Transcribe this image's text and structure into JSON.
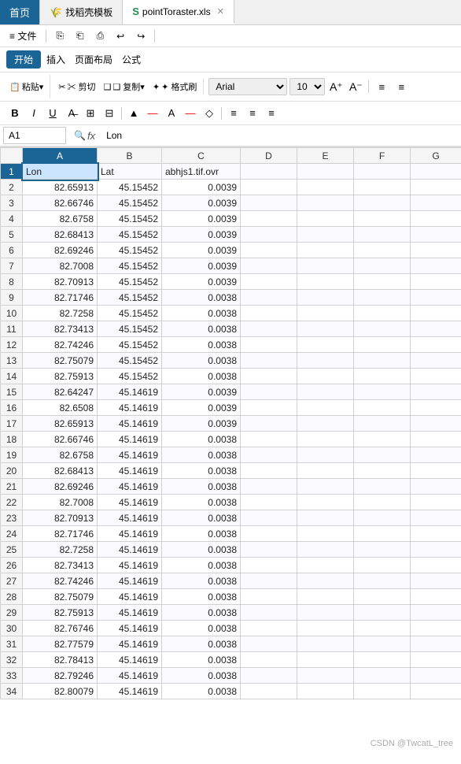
{
  "tabs": [
    {
      "label": "首页",
      "icon": "",
      "type": "home",
      "active": false
    },
    {
      "label": "找稻壳模板",
      "icon": "🌾",
      "type": "wps",
      "active": false
    },
    {
      "label": "pointToraster.xls",
      "icon": "S",
      "type": "xls",
      "active": true,
      "closable": true
    }
  ],
  "menu": {
    "items": [
      "≡ 文件",
      "⎘",
      "⎗",
      "⎙",
      "↩",
      "↪",
      "▶"
    ]
  },
  "ribbon": {
    "tabs": [
      "开始",
      "插入",
      "页面布局",
      "公式"
    ],
    "active": "开始"
  },
  "formatting": {
    "font": "Arial",
    "size": "10",
    "bold": "B",
    "italic": "I",
    "underline": "U",
    "strikethrough": "A̶",
    "border": "⊞",
    "merge": "⊟",
    "fill_color": "▲",
    "font_color": "A",
    "clear": "◇"
  },
  "paste_section": {
    "paste_label": "粘贴▾",
    "cut_label": "✂ 剪切",
    "copy_label": "❑ 复制▾",
    "format_label": "✦ 格式刷"
  },
  "formula_bar": {
    "cell_ref": "A1",
    "fx_label": "fx",
    "formula_value": "Lon"
  },
  "columns": {
    "corner": "",
    "headers": [
      "A",
      "B",
      "C",
      "D",
      "E",
      "F",
      "G"
    ]
  },
  "spreadsheet": {
    "headers": [
      "Lon",
      "Lat",
      "abhjs1.tif.ovr"
    ],
    "rows": [
      {
        "row": 1,
        "A": "Lon",
        "B": "Lat",
        "C": "abhjs1.tif.ovr",
        "D": "",
        "E": "",
        "F": "",
        "G": ""
      },
      {
        "row": 2,
        "A": "82.65913",
        "B": "45.15452",
        "C": "0.0039",
        "D": "",
        "E": "",
        "F": "",
        "G": ""
      },
      {
        "row": 3,
        "A": "82.66746",
        "B": "45.15452",
        "C": "0.0039",
        "D": "",
        "E": "",
        "F": "",
        "G": ""
      },
      {
        "row": 4,
        "A": "82.6758",
        "B": "45.15452",
        "C": "0.0039",
        "D": "",
        "E": "",
        "F": "",
        "G": ""
      },
      {
        "row": 5,
        "A": "82.68413",
        "B": "45.15452",
        "C": "0.0039",
        "D": "",
        "E": "",
        "F": "",
        "G": ""
      },
      {
        "row": 6,
        "A": "82.69246",
        "B": "45.15452",
        "C": "0.0039",
        "D": "",
        "E": "",
        "F": "",
        "G": ""
      },
      {
        "row": 7,
        "A": "82.7008",
        "B": "45.15452",
        "C": "0.0039",
        "D": "",
        "E": "",
        "F": "",
        "G": ""
      },
      {
        "row": 8,
        "A": "82.70913",
        "B": "45.15452",
        "C": "0.0039",
        "D": "",
        "E": "",
        "F": "",
        "G": ""
      },
      {
        "row": 9,
        "A": "82.71746",
        "B": "45.15452",
        "C": "0.0038",
        "D": "",
        "E": "",
        "F": "",
        "G": ""
      },
      {
        "row": 10,
        "A": "82.7258",
        "B": "45.15452",
        "C": "0.0038",
        "D": "",
        "E": "",
        "F": "",
        "G": ""
      },
      {
        "row": 11,
        "A": "82.73413",
        "B": "45.15452",
        "C": "0.0038",
        "D": "",
        "E": "",
        "F": "",
        "G": ""
      },
      {
        "row": 12,
        "A": "82.74246",
        "B": "45.15452",
        "C": "0.0038",
        "D": "",
        "E": "",
        "F": "",
        "G": ""
      },
      {
        "row": 13,
        "A": "82.75079",
        "B": "45.15452",
        "C": "0.0038",
        "D": "",
        "E": "",
        "F": "",
        "G": ""
      },
      {
        "row": 14,
        "A": "82.75913",
        "B": "45.15452",
        "C": "0.0038",
        "D": "",
        "E": "",
        "F": "",
        "G": ""
      },
      {
        "row": 15,
        "A": "82.64247",
        "B": "45.14619",
        "C": "0.0039",
        "D": "",
        "E": "",
        "F": "",
        "G": ""
      },
      {
        "row": 16,
        "A": "82.6508",
        "B": "45.14619",
        "C": "0.0039",
        "D": "",
        "E": "",
        "F": "",
        "G": ""
      },
      {
        "row": 17,
        "A": "82.65913",
        "B": "45.14619",
        "C": "0.0039",
        "D": "",
        "E": "",
        "F": "",
        "G": ""
      },
      {
        "row": 18,
        "A": "82.66746",
        "B": "45.14619",
        "C": "0.0038",
        "D": "",
        "E": "",
        "F": "",
        "G": ""
      },
      {
        "row": 19,
        "A": "82.6758",
        "B": "45.14619",
        "C": "0.0038",
        "D": "",
        "E": "",
        "F": "",
        "G": ""
      },
      {
        "row": 20,
        "A": "82.68413",
        "B": "45.14619",
        "C": "0.0038",
        "D": "",
        "E": "",
        "F": "",
        "G": ""
      },
      {
        "row": 21,
        "A": "82.69246",
        "B": "45.14619",
        "C": "0.0038",
        "D": "",
        "E": "",
        "F": "",
        "G": ""
      },
      {
        "row": 22,
        "A": "82.7008",
        "B": "45.14619",
        "C": "0.0038",
        "D": "",
        "E": "",
        "F": "",
        "G": ""
      },
      {
        "row": 23,
        "A": "82.70913",
        "B": "45.14619",
        "C": "0.0038",
        "D": "",
        "E": "",
        "F": "",
        "G": ""
      },
      {
        "row": 24,
        "A": "82.71746",
        "B": "45.14619",
        "C": "0.0038",
        "D": "",
        "E": "",
        "F": "",
        "G": ""
      },
      {
        "row": 25,
        "A": "82.7258",
        "B": "45.14619",
        "C": "0.0038",
        "D": "",
        "E": "",
        "F": "",
        "G": ""
      },
      {
        "row": 26,
        "A": "82.73413",
        "B": "45.14619",
        "C": "0.0038",
        "D": "",
        "E": "",
        "F": "",
        "G": ""
      },
      {
        "row": 27,
        "A": "82.74246",
        "B": "45.14619",
        "C": "0.0038",
        "D": "",
        "E": "",
        "F": "",
        "G": ""
      },
      {
        "row": 28,
        "A": "82.75079",
        "B": "45.14619",
        "C": "0.0038",
        "D": "",
        "E": "",
        "F": "",
        "G": ""
      },
      {
        "row": 29,
        "A": "82.75913",
        "B": "45.14619",
        "C": "0.0038",
        "D": "",
        "E": "",
        "F": "",
        "G": ""
      },
      {
        "row": 30,
        "A": "82.76746",
        "B": "45.14619",
        "C": "0.0038",
        "D": "",
        "E": "",
        "F": "",
        "G": ""
      },
      {
        "row": 31,
        "A": "82.77579",
        "B": "45.14619",
        "C": "0.0038",
        "D": "",
        "E": "",
        "F": "",
        "G": ""
      },
      {
        "row": 32,
        "A": "82.78413",
        "B": "45.14619",
        "C": "0.0038",
        "D": "",
        "E": "",
        "F": "",
        "G": ""
      },
      {
        "row": 33,
        "A": "82.79246",
        "B": "45.14619",
        "C": "0.0038",
        "D": "",
        "E": "",
        "F": "",
        "G": ""
      },
      {
        "row": 34,
        "A": "82.80079",
        "B": "45.14619",
        "C": "0.0038",
        "D": "",
        "E": "",
        "F": "",
        "G": ""
      }
    ]
  },
  "watermark": "CSDN @TwcatL_tree",
  "colors": {
    "accent": "#1a6496",
    "header_bg": "#f5f5f5",
    "border": "#d0d0d0",
    "selected_bg": "#cce5ff",
    "home_tab": "#1a6496",
    "row_even": "#f9f9ff"
  }
}
